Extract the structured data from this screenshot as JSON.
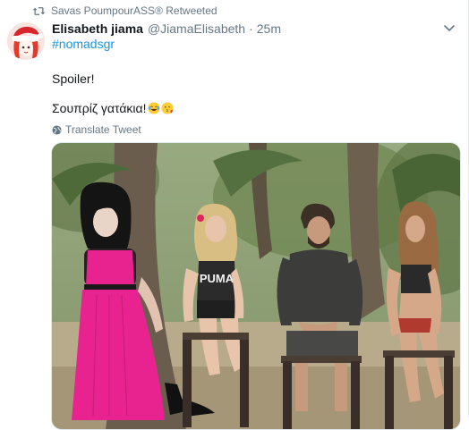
{
  "retweet": {
    "text": "Savas PoumpourASS® Retweeted",
    "icon": "retweet-icon"
  },
  "author": {
    "display_name": "Elisabeth jiama",
    "handle": "@JiamaElisabeth",
    "separator": "·",
    "time": "25m",
    "avatar": "avatar-with-santa-hat"
  },
  "tweet": {
    "hashtag": "#nomadsgr",
    "line1": "Spoiler!",
    "line2": "Σουπρίζ γατάκια!",
    "emojis": [
      "face-with-tears-of-joy",
      "face-blowing-a-kiss"
    ]
  },
  "translate": {
    "label": "Translate Tweet",
    "icon": "globe-icon"
  },
  "media": {
    "description_icon": "photo",
    "shirt_text": "PUMA"
  },
  "colors": {
    "link": "#1b95e0",
    "secondary_text": "#657786",
    "primary_text": "#14171a",
    "skirt_pink": "#e8238f"
  }
}
